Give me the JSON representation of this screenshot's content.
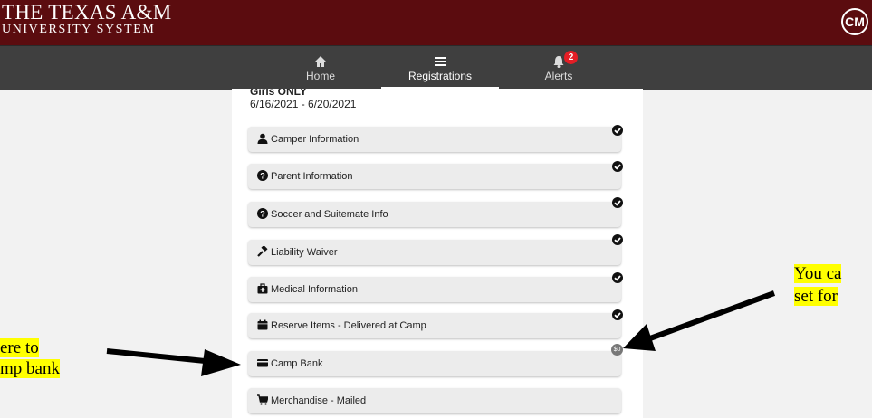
{
  "header": {
    "logo_line1": "THE TEXAS A&M",
    "logo_line2": "UNIVERSITY SYSTEM",
    "user_initials": "CM",
    "brand_color": "#5b0c0f"
  },
  "nav": {
    "tabs": [
      {
        "label": "Home",
        "icon": "home-icon"
      },
      {
        "label": "Registrations",
        "icon": "list-icon"
      },
      {
        "label": "Alerts",
        "icon": "bell-icon"
      }
    ],
    "active_tab": "Registrations",
    "alerts_count": "2"
  },
  "registration": {
    "title": "Girls ONLY",
    "dates": "6/16/2021 - 6/20/2021"
  },
  "sections": [
    {
      "label": "Camper Information",
      "icon": "user-icon",
      "status": "complete"
    },
    {
      "label": "Parent Information",
      "icon": "question-circle-icon",
      "status": "complete"
    },
    {
      "label": "Soccer and Suitemate Info",
      "icon": "question-circle-icon",
      "status": "complete"
    },
    {
      "label": "Liability Waiver",
      "icon": "gavel-icon",
      "status": "complete"
    },
    {
      "label": "Medical Information",
      "icon": "medkit-icon",
      "status": "complete"
    },
    {
      "label": "Reserve Items - Delivered at Camp",
      "icon": "calendar-icon",
      "status": "complete"
    },
    {
      "label": "Camp Bank",
      "icon": "credit-card-icon",
      "status": "$0"
    },
    {
      "label": "Merchandise - Mailed",
      "icon": "cart-icon",
      "status": ""
    }
  ],
  "annotations": {
    "left_line1": "ere to",
    "left_line2": "mp bank",
    "right_line1": "You ca",
    "right_line2": "set for",
    "highlight_color": "#ffff00"
  }
}
